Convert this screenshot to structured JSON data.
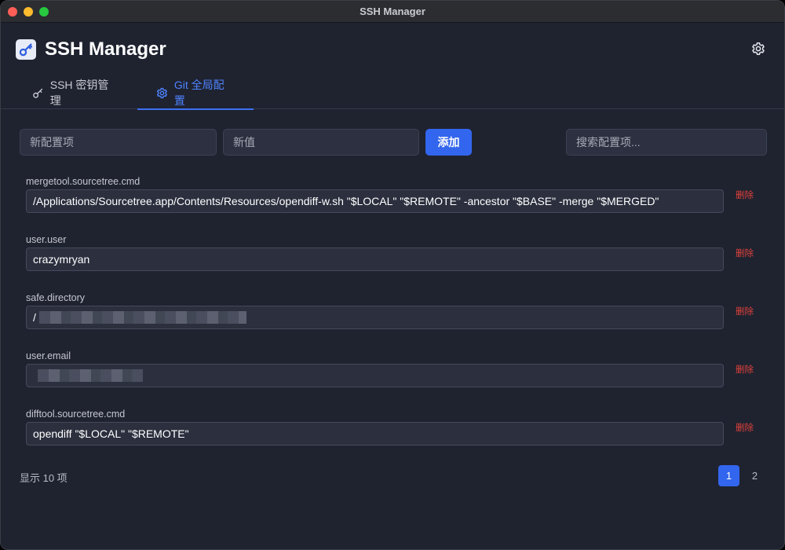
{
  "window": {
    "title": "SSH Manager"
  },
  "header": {
    "title": "SSH Manager"
  },
  "tabs": [
    {
      "label": "SSH 密钥管理",
      "active": false
    },
    {
      "label": "Git 全局配置",
      "active": true
    }
  ],
  "toolbar": {
    "key_placeholder": "新配置项",
    "value_placeholder": "新值",
    "add_label": "添加",
    "search_placeholder": "搜索配置项..."
  },
  "entries": [
    {
      "key": "mergetool.sourcetree.cmd",
      "value": "/Applications/Sourcetree.app/Contents/Resources/opendiff-w.sh \"$LOCAL\" \"$REMOTE\" -ancestor \"$BASE\" -merge \"$MERGED\"",
      "delete_label": "删除"
    },
    {
      "key": "user.user",
      "value": "crazymryan",
      "delete_label": "删除"
    },
    {
      "key": "safe.directory",
      "value": "/",
      "delete_label": "删除"
    },
    {
      "key": "user.email",
      "value": "",
      "delete_label": "删除"
    },
    {
      "key": "difftool.sourcetree.cmd",
      "value": "opendiff \"$LOCAL\" \"$REMOTE\"",
      "delete_label": "删除"
    }
  ],
  "footer": {
    "count_text": "显示 10 项",
    "pages": [
      "1",
      "2"
    ],
    "current_page": "1"
  },
  "colors": {
    "accent": "#3366ee",
    "danger": "#e0413a",
    "background": "#1f2330"
  },
  "icons": {
    "logo": "key-icon",
    "settings": "gear-icon",
    "tab_ssh": "key-icon",
    "tab_git": "gear-icon"
  }
}
